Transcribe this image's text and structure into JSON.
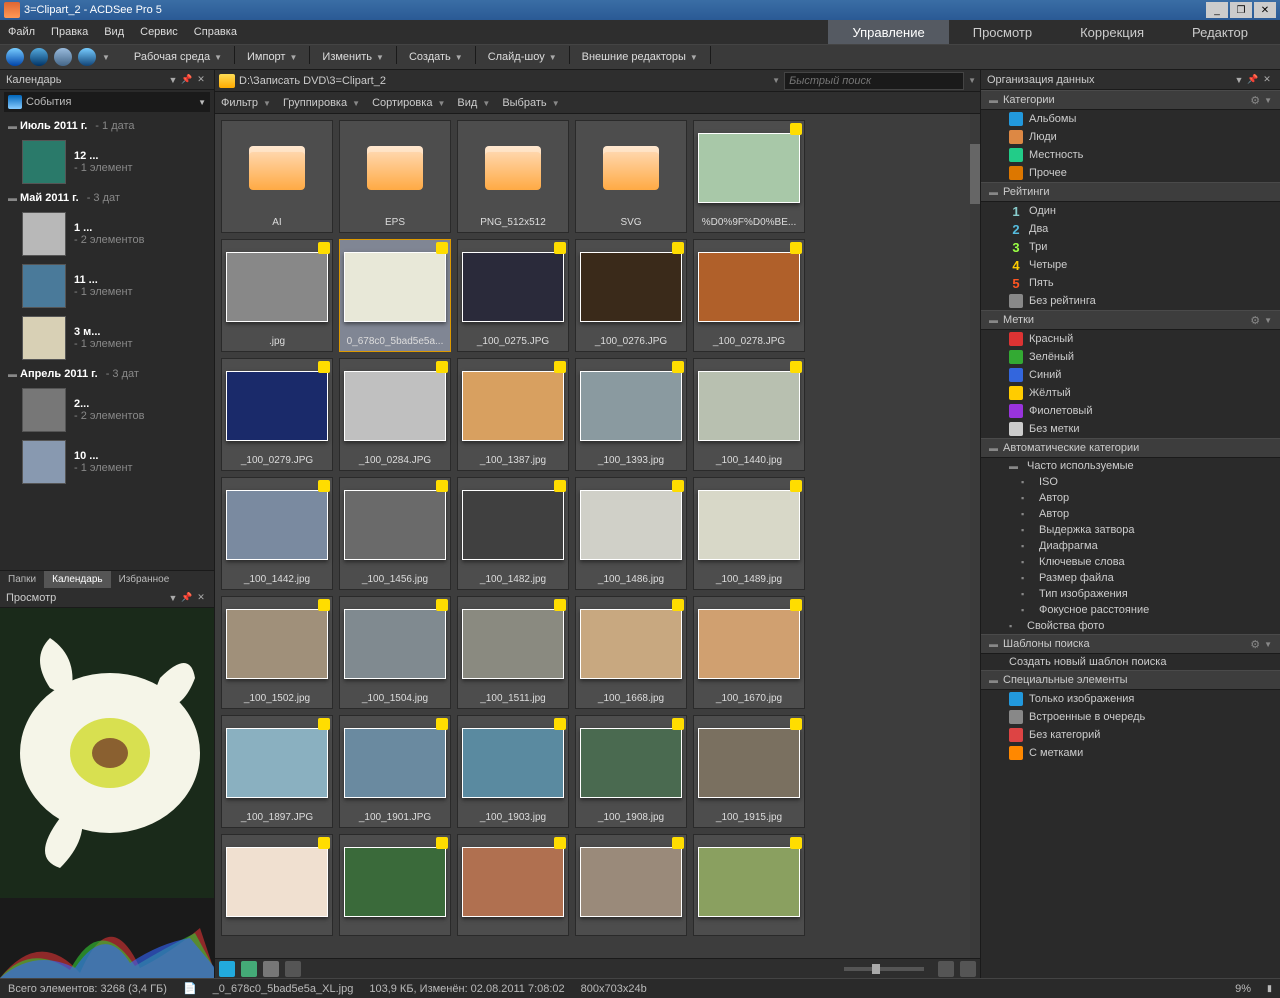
{
  "title": "3=Clipart_2 - ACDSee Pro 5",
  "menu": {
    "file": "Файл",
    "edit": "Правка",
    "view": "Вид",
    "service": "Сервис",
    "help": "Справка"
  },
  "modeTabs": {
    "manage": "Управление",
    "view": "Просмотр",
    "develop": "Коррекция",
    "edit": "Редактор"
  },
  "toolbar": [
    "Рабочая среда",
    "Импорт",
    "Изменить",
    "Создать",
    "Слайд-шоу",
    "Внешние редакторы"
  ],
  "calendar": {
    "title": "Календарь",
    "eventsLabel": "События",
    "months": [
      {
        "name": "Июль 2011 г.",
        "meta": "- 1 дата",
        "days": [
          {
            "num": "12 ...",
            "meta": "- 1 элемент",
            "bg": "#2a7a6a"
          }
        ]
      },
      {
        "name": "Май 2011 г.",
        "meta": "- 3 дат",
        "days": [
          {
            "num": "1 ...",
            "meta": "- 2 элементов",
            "bg": "#b8b8b8"
          },
          {
            "num": "11 ...",
            "meta": "- 1 элемент",
            "bg": "#4a7a9a"
          },
          {
            "num": "3 м...",
            "meta": "- 1 элемент",
            "bg": "#d8d0b5"
          }
        ]
      },
      {
        "name": "Апрель 2011 г.",
        "meta": "- 3 дат",
        "days": [
          {
            "num": "2...",
            "meta": "- 2 элементов",
            "bg": "#777"
          },
          {
            "num": "10 ...",
            "meta": "- 1 элемент",
            "bg": "#8899b0"
          }
        ]
      }
    ],
    "tabs": {
      "folders": "Папки",
      "calendar": "Календарь",
      "favorites": "Избранное"
    }
  },
  "preview": {
    "title": "Просмотр"
  },
  "path": "D:\\Записать DVD\\3=Clipart_2",
  "searchPlaceholder": "Быстрый поиск",
  "filterbar": [
    "Фильтр",
    "Группировка",
    "Сортировка",
    "Вид",
    "Выбрать"
  ],
  "thumbs": [
    [
      {
        "t": "folder",
        "l": "AI"
      },
      {
        "t": "folder",
        "l": "EPS"
      },
      {
        "t": "folder",
        "l": "PNG_512x512"
      },
      {
        "t": "folder",
        "l": "SVG"
      },
      {
        "t": "img",
        "l": "%D0%9F%D0%BE...",
        "bg": "#a8c8a8"
      }
    ],
    [
      {
        "t": "img",
        "l": ".jpg",
        "bg": "#888"
      },
      {
        "t": "img",
        "l": "0_678c0_5bad5e5a...",
        "bg": "#e8e8d8",
        "sel": true
      },
      {
        "t": "img",
        "l": "_100_0275.JPG",
        "bg": "#2a2a3a"
      },
      {
        "t": "img",
        "l": "_100_0276.JPG",
        "bg": "#3a2a1a"
      },
      {
        "t": "img",
        "l": "_100_0278.JPG",
        "bg": "#b0602a"
      }
    ],
    [
      {
        "t": "img",
        "l": "_100_0279.JPG",
        "bg": "#1a2a6a"
      },
      {
        "t": "img",
        "l": "_100_0284.JPG",
        "bg": "#c0c0c0"
      },
      {
        "t": "img",
        "l": "_100_1387.jpg",
        "bg": "#d8a060"
      },
      {
        "t": "img",
        "l": "_100_1393.jpg",
        "bg": "#8a9aa0"
      },
      {
        "t": "img",
        "l": "_100_1440.jpg",
        "bg": "#b8c0b0"
      }
    ],
    [
      {
        "t": "img",
        "l": "_100_1442.jpg",
        "bg": "#7a8aa0"
      },
      {
        "t": "img",
        "l": "_100_1456.jpg",
        "bg": "#6a6a6a"
      },
      {
        "t": "img",
        "l": "_100_1482.jpg",
        "bg": "#404040"
      },
      {
        "t": "img",
        "l": "_100_1486.jpg",
        "bg": "#d0d0c8"
      },
      {
        "t": "img",
        "l": "_100_1489.jpg",
        "bg": "#d8d8c8"
      }
    ],
    [
      {
        "t": "img",
        "l": "_100_1502.jpg",
        "bg": "#a0907a"
      },
      {
        "t": "img",
        "l": "_100_1504.jpg",
        "bg": "#808a90"
      },
      {
        "t": "img",
        "l": "_100_1511.jpg",
        "bg": "#8a8a80"
      },
      {
        "t": "img",
        "l": "_100_1668.jpg",
        "bg": "#c8a880"
      },
      {
        "t": "img",
        "l": "_100_1670.jpg",
        "bg": "#d0a070"
      }
    ],
    [
      {
        "t": "img",
        "l": "_100_1897.JPG",
        "bg": "#8ab0c0"
      },
      {
        "t": "img",
        "l": "_100_1901.JPG",
        "bg": "#6a8aa0"
      },
      {
        "t": "img",
        "l": "_100_1903.jpg",
        "bg": "#5a8aa0"
      },
      {
        "t": "img",
        "l": "_100_1908.jpg",
        "bg": "#4a6a50"
      },
      {
        "t": "img",
        "l": "_100_1915.jpg",
        "bg": "#7a7060"
      }
    ],
    [
      {
        "t": "img",
        "l": "",
        "bg": "#f0e0d0"
      },
      {
        "t": "img",
        "l": "",
        "bg": "#3a6a3a"
      },
      {
        "t": "img",
        "l": "",
        "bg": "#b07050"
      },
      {
        "t": "img",
        "l": "",
        "bg": "#9a8a7a"
      },
      {
        "t": "img",
        "l": "",
        "bg": "#8aa060"
      }
    ]
  ],
  "org": {
    "title": "Организация данных",
    "categories": {
      "title": "Категории",
      "items": [
        {
          "label": "Альбомы",
          "color": "#29d"
        },
        {
          "label": "Люди",
          "color": "#d84"
        },
        {
          "label": "Местность",
          "color": "#2c8"
        },
        {
          "label": "Прочее",
          "color": "#d70"
        }
      ]
    },
    "ratings": {
      "title": "Рейтинги",
      "items": [
        {
          "num": "1",
          "label": "Один",
          "color": "#8cc"
        },
        {
          "num": "2",
          "label": "Два",
          "color": "#5bd"
        },
        {
          "num": "3",
          "label": "Три",
          "color": "#9f4"
        },
        {
          "num": "4",
          "label": "Четыре",
          "color": "#fc0"
        },
        {
          "num": "5",
          "label": "Пять",
          "color": "#f52"
        }
      ],
      "noRating": "Без рейтинга"
    },
    "labels": {
      "title": "Метки",
      "items": [
        {
          "label": "Красный",
          "color": "#d33"
        },
        {
          "label": "Зелёный",
          "color": "#3a3"
        },
        {
          "label": "Синий",
          "color": "#36d"
        },
        {
          "label": "Жёлтый",
          "color": "#fc0"
        },
        {
          "label": "Фиолетовый",
          "color": "#93d"
        }
      ],
      "noLabel": "Без метки"
    },
    "auto": {
      "title": "Автоматические категории",
      "frequent": "Часто используемые",
      "items": [
        "ISO",
        "Автор",
        "Автор",
        "Выдержка затвора",
        "Диафрагма",
        "Ключевые слова",
        "Размер файла",
        "Тип изображения",
        "Фокусное расстояние"
      ],
      "props": "Свойства фото"
    },
    "search": {
      "title": "Шаблоны поиска",
      "create": "Создать новый шаблон поиска"
    },
    "special": {
      "title": "Специальные элементы",
      "items": [
        {
          "label": "Только изображения",
          "color": "#29d"
        },
        {
          "label": "Встроенные в очередь",
          "color": "#888"
        },
        {
          "label": "Без категорий",
          "color": "#d44"
        },
        {
          "label": "С метками",
          "color": "#f80"
        }
      ]
    }
  },
  "status": {
    "total": "Всего элементов: 3268  (3,4 ГБ)",
    "file": "_0_678c0_5bad5e5a_XL.jpg",
    "size": "103,9 КБ, Изменён: 02.08.2011 7:08:02",
    "dims": "800x703x24b",
    "zoom": "9%"
  }
}
